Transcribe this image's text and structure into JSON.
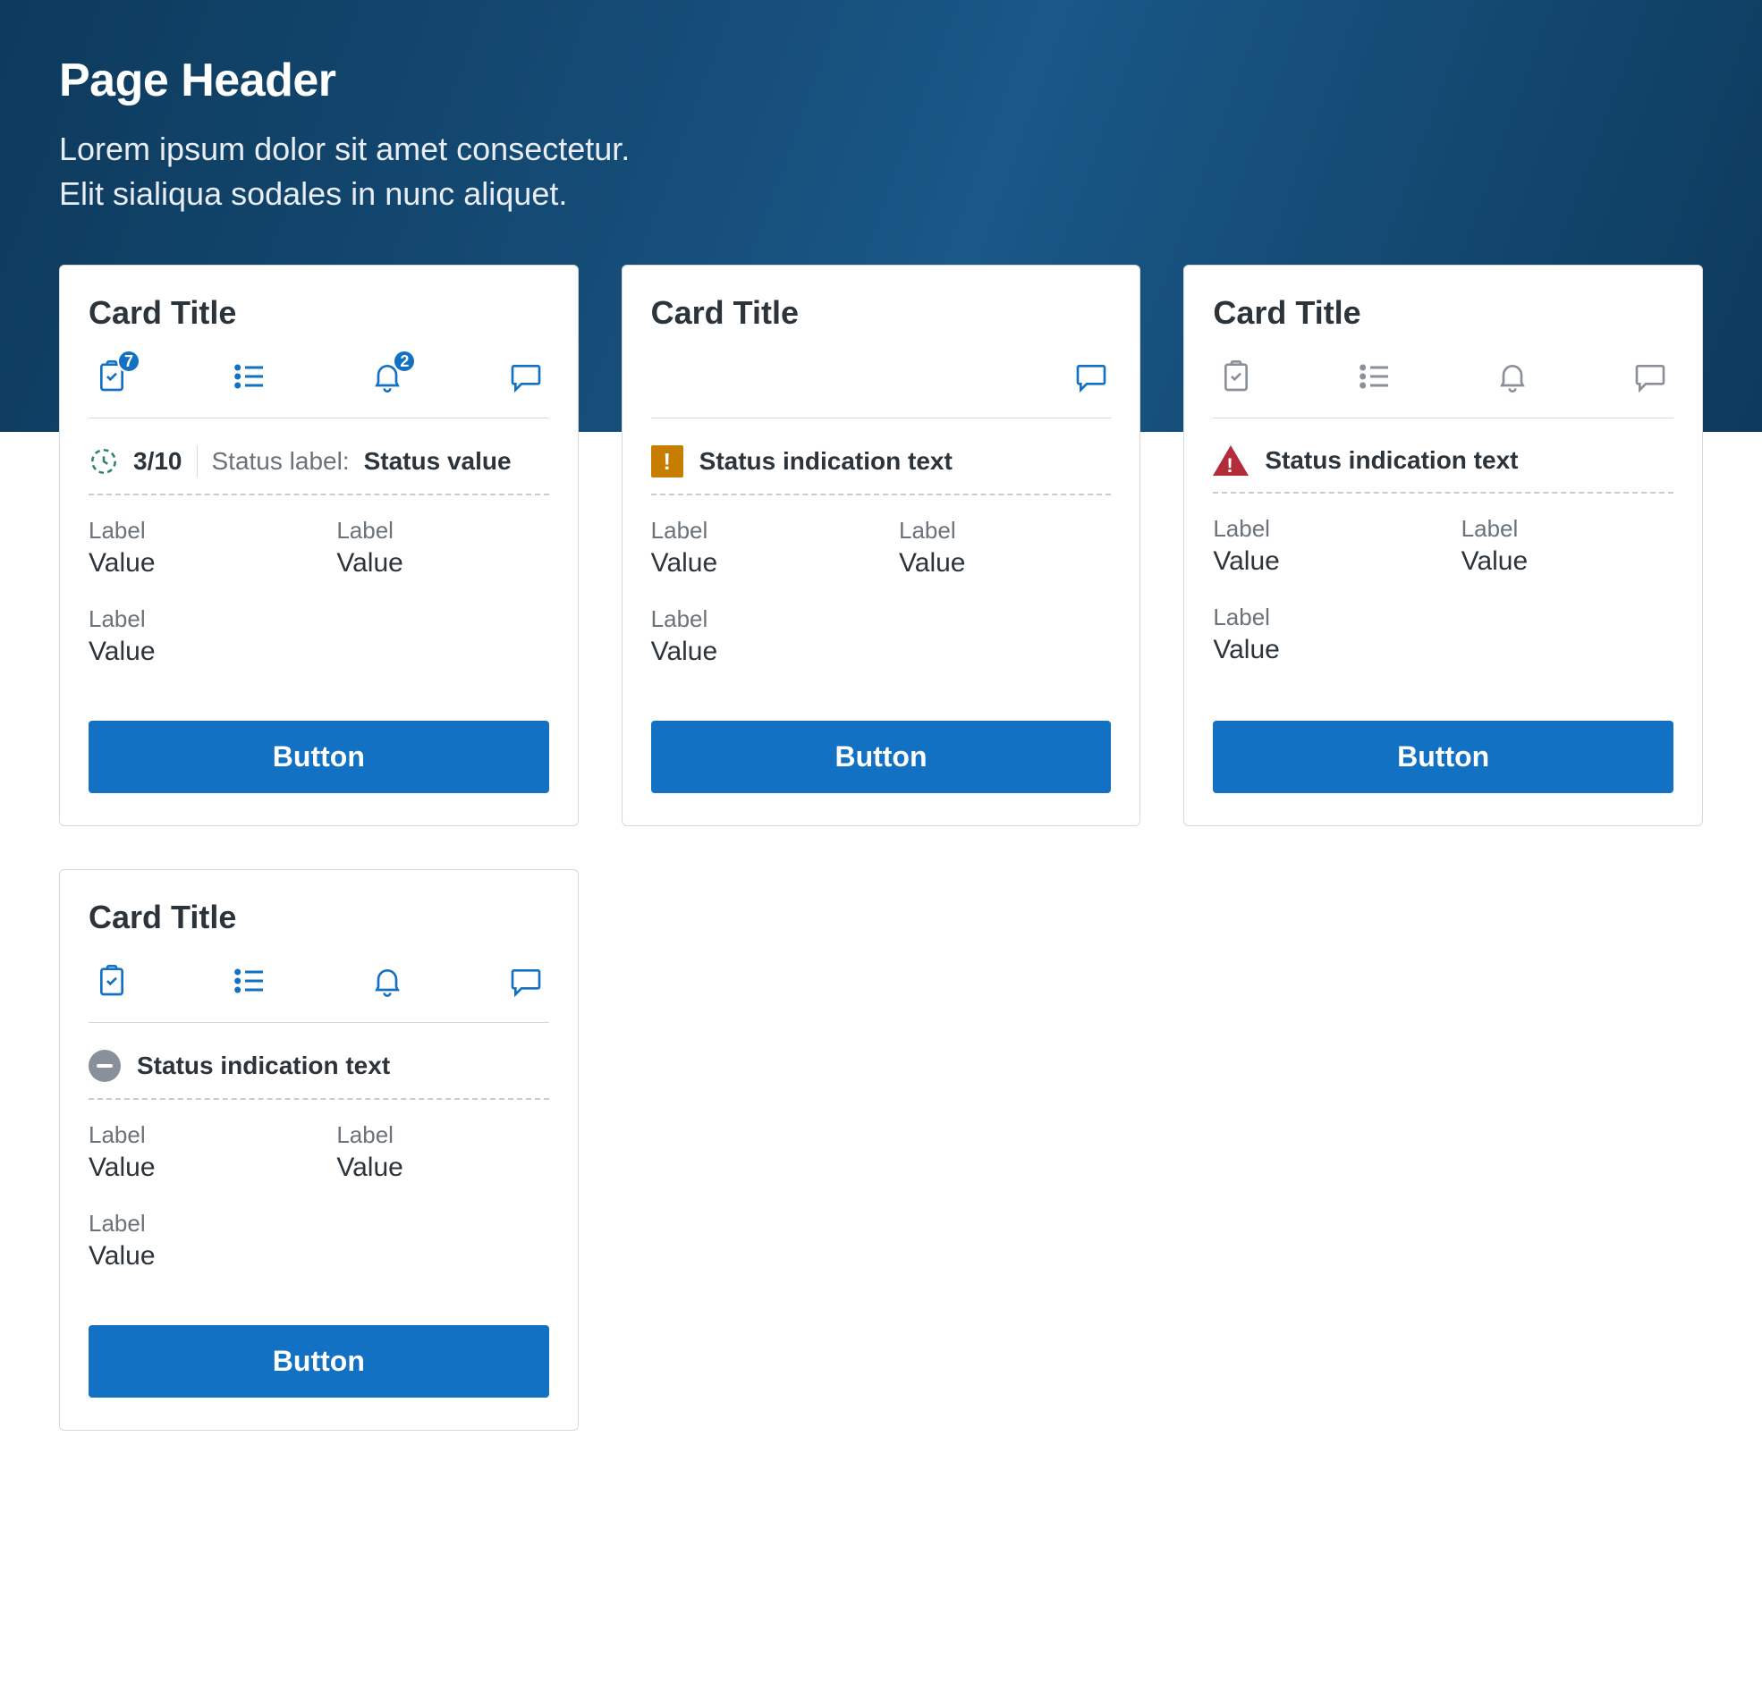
{
  "header": {
    "title": "Page Header",
    "subtitle_line1": "Lorem ipsum dolor sit amet consectetur.",
    "subtitle_line2": "Elit sialiqua sodales in nunc aliquet."
  },
  "colors": {
    "primary": "#1371c3",
    "icon_muted": "#8a909a",
    "warning": "#c77d00",
    "error": "#b22c3a",
    "neutral": "#8a909a",
    "success": "#2f8560"
  },
  "cards": [
    {
      "title": "Card Title",
      "icons_color": "primary",
      "clipboard_badge": "7",
      "bell_badge": "2",
      "status_type": "progress",
      "progress": "3/10",
      "status_label": "Status label:",
      "status_value": "Status value",
      "fields": [
        {
          "label": "Label",
          "value": "Value"
        },
        {
          "label": "Label",
          "value": "Value"
        },
        {
          "label": "Label",
          "value": "Value"
        }
      ],
      "button": "Button"
    },
    {
      "title": "Card Title",
      "icons_mode": "comment_only",
      "status_type": "warning",
      "status_text": "Status indication text",
      "fields": [
        {
          "label": "Label",
          "value": "Value"
        },
        {
          "label": "Label",
          "value": "Value"
        },
        {
          "label": "Label",
          "value": "Value"
        }
      ],
      "button": "Button"
    },
    {
      "title": "Card Title",
      "icons_color": "muted",
      "status_type": "error",
      "status_text": "Status indication text",
      "fields": [
        {
          "label": "Label",
          "value": "Value"
        },
        {
          "label": "Label",
          "value": "Value"
        },
        {
          "label": "Label",
          "value": "Value"
        }
      ],
      "button": "Button"
    },
    {
      "title": "Card Title",
      "icons_color": "primary",
      "status_type": "neutral",
      "status_text": "Status indication text",
      "fields": [
        {
          "label": "Label",
          "value": "Value"
        },
        {
          "label": "Label",
          "value": "Value"
        },
        {
          "label": "Label",
          "value": "Value"
        }
      ],
      "button": "Button"
    }
  ]
}
